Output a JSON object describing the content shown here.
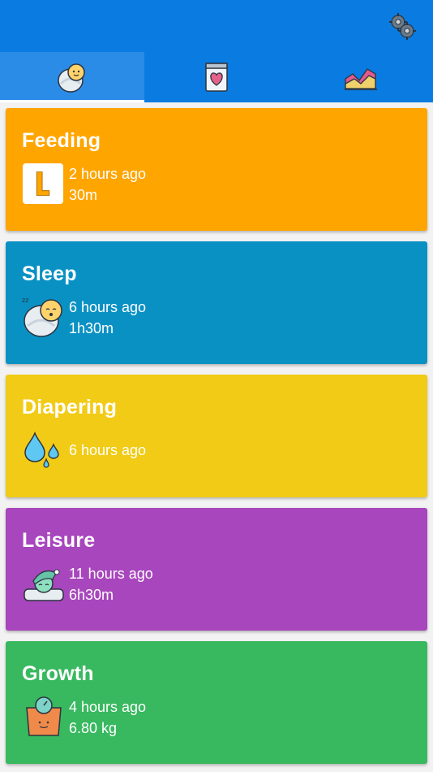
{
  "colors": {
    "appbar": "#0a7be0",
    "tab_active": "#2a8ce6",
    "feeding": "#ffa500",
    "sleep": "#0a91c4",
    "diapering": "#f1cb16",
    "leisure": "#a846bd",
    "growth": "#38b85f"
  },
  "appbar": {
    "settings_icon": "gears-icon"
  },
  "tabs": [
    {
      "icon": "baby-icon",
      "active": true
    },
    {
      "icon": "heart-card-icon",
      "active": false
    },
    {
      "icon": "area-chart-icon",
      "active": false
    }
  ],
  "cards": {
    "feeding": {
      "title": "Feeding",
      "icon": "bottle-l-icon",
      "line1": "2 hours ago",
      "line2": "30m"
    },
    "sleep": {
      "title": "Sleep",
      "icon": "sleeping-baby-icon",
      "line1": "6 hours ago",
      "line2": "1h30m"
    },
    "diapering": {
      "title": "Diapering",
      "icon": "water-drops-icon",
      "line1": "6 hours ago"
    },
    "leisure": {
      "title": "Leisure",
      "icon": "sleeping-cap-icon",
      "line1": "11 hours ago",
      "line2": "6h30m"
    },
    "growth": {
      "title": "Growth",
      "icon": "scale-icon",
      "line1": "4 hours ago",
      "line2": "6.80 kg"
    }
  }
}
